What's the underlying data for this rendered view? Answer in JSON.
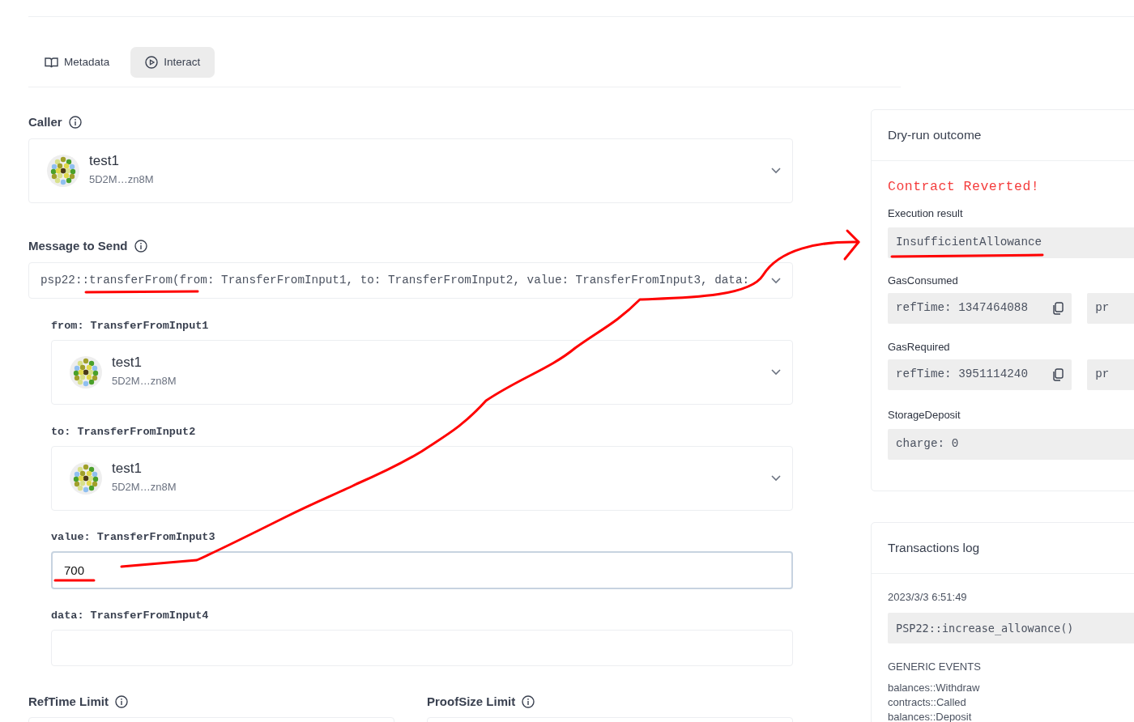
{
  "tabs": [
    {
      "label": "Metadata",
      "selected": false
    },
    {
      "label": "Interact",
      "selected": true
    }
  ],
  "caller": {
    "label": "Caller",
    "name": "test1",
    "address": "5D2M…zn8M"
  },
  "message": {
    "label": "Message to Send",
    "value": "psp22::transferFrom(from: TransferFromInput1, to: TransferFromInput2, value: TransferFromInput3, data:"
  },
  "args": [
    {
      "kind": "account",
      "label": "from: TransferFromInput1",
      "name": "test1",
      "address": "5D2M…zn8M"
    },
    {
      "kind": "account",
      "label": "to: TransferFromInput2",
      "name": "test1",
      "address": "5D2M…zn8M"
    },
    {
      "kind": "text",
      "label": "value: TransferFromInput3",
      "value": "700",
      "focused": true
    },
    {
      "kind": "text",
      "label": "data: TransferFromInput4",
      "focused": false
    }
  ],
  "limits": [
    {
      "label": "RefTime Limit"
    },
    {
      "label": "ProofSize Limit"
    }
  ],
  "dry_run": {
    "title": "Dry-run outcome",
    "status": "Contract Reverted!",
    "result_label": "Execution result",
    "result": "InsufficientAllowance",
    "gas": [
      {
        "label": "GasConsumed",
        "ref_time": "refTime: 1347464088",
        "proof": "pr"
      },
      {
        "label": "GasRequired",
        "ref_time": "refTime: 3951114240",
        "proof": "pr"
      }
    ],
    "storage_label": "StorageDeposit",
    "storage": "charge: 0"
  },
  "log": {
    "title": "Transactions log",
    "entries": [
      {
        "time": "2023/3/3 6:51:49",
        "call": "PSP22::increase_allowance()",
        "events_label": "GENERIC EVENTS",
        "events": [
          "balances::Withdraw",
          "contracts::Called",
          "balances::Deposit"
        ]
      }
    ]
  }
}
